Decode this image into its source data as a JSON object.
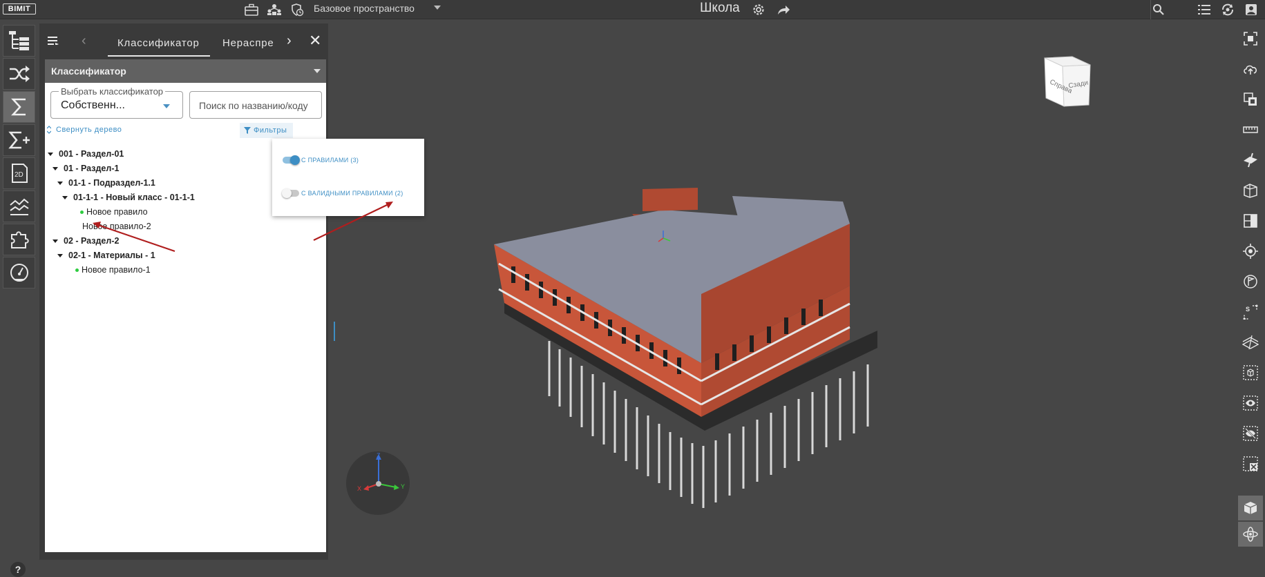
{
  "app": {
    "logo": "BIMIT",
    "space": "Базовое пространство",
    "project_title": "Школа"
  },
  "panel": {
    "tabs": [
      {
        "label": "Классификатор",
        "active": true
      },
      {
        "label": "Нераспре",
        "active": false
      }
    ],
    "header": "Классификатор",
    "classifier_select": {
      "legend": "Выбрать классификатор",
      "value": "Собственн..."
    },
    "search": {
      "placeholder": "Поиск по названию/коду"
    },
    "collapse_label": "Свернуть дерево",
    "filters_label": "Фильтры",
    "tree": [
      {
        "label": "001 - Раздел-01",
        "level": 0,
        "bold": true,
        "caret": true
      },
      {
        "label": "01 - Раздел-1",
        "level": 1,
        "bold": true,
        "caret": true
      },
      {
        "label": "01-1 - Подраздел-1.1",
        "level": 2,
        "bold": true,
        "caret": true
      },
      {
        "label": "01-1-1 - Новый класс - 01-1-1",
        "level": 3,
        "bold": true,
        "caret": true
      },
      {
        "label": "Новое правило",
        "level": 4,
        "dot": true
      },
      {
        "label": "Новое правило-2",
        "level": 4,
        "dot": false
      },
      {
        "label": "02 - Раздел-2",
        "level": 1,
        "bold": true,
        "caret": true
      },
      {
        "label": "02-1 - Материалы - 1",
        "level": 2,
        "bold": true,
        "caret": true
      },
      {
        "label": "Новое правило-1",
        "level": 3,
        "dot": true
      }
    ]
  },
  "filter_popup": {
    "options": [
      {
        "label": "С ПРАВИЛАМИ (3)",
        "enabled": true
      },
      {
        "label": "С ВАЛИДНЫМИ ПРАВИЛАМИ (2)",
        "enabled": false
      }
    ]
  },
  "viewcube": {
    "face_front": "Справа",
    "face_right": "Сзади"
  },
  "gizmo": {
    "x": "X",
    "y": "Y",
    "z": "Z"
  },
  "help": "?",
  "colors": {
    "accent": "#3d8ec4",
    "dot": "#2ecc40",
    "arrow": "#b01e1e",
    "facade": "#c8563a",
    "roof": "#8a8e9e"
  }
}
